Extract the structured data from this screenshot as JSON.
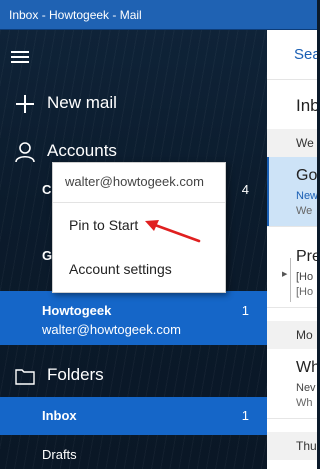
{
  "window": {
    "title": "Inbox - Howtogeek - Mail"
  },
  "nav": {
    "new_mail": "New mail",
    "accounts": "Accounts",
    "account_rows": [
      {
        "name": "C",
        "count": "4"
      },
      {
        "name": "G",
        "count": ""
      }
    ],
    "selected_account": {
      "name": "Howtogeek",
      "email": "walter@howtogeek.com",
      "count": "1"
    },
    "folders": "Folders",
    "folder_items": [
      {
        "name": "Inbox",
        "count": "1"
      },
      {
        "name": "Drafts",
        "count": ""
      }
    ]
  },
  "context_menu": {
    "header": "walter@howtogeek.com",
    "items": [
      "Pin to Start",
      "Account settings"
    ]
  },
  "message_list": {
    "search": "Sea",
    "title": "Inb",
    "groups": [
      "We",
      "Mo",
      "Thu"
    ],
    "messages": [
      {
        "from": "Go",
        "subject": "New",
        "preview": "We"
      },
      {
        "from": "Pre",
        "subject": "[Ho",
        "preview": "[Ho"
      },
      {
        "from": "Wh",
        "subject": "Nev",
        "preview": "Wh"
      }
    ]
  },
  "colors": {
    "accent": "#1566c8",
    "titlebar": "#1f62b3",
    "annotation_arrow": "#e02020"
  }
}
